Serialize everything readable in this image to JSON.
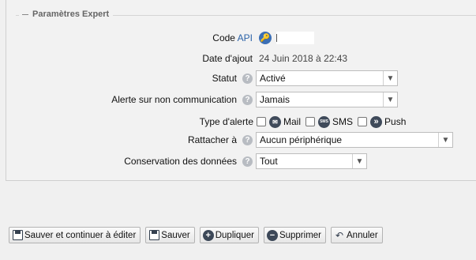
{
  "fieldset": {
    "legend": "Paramètres Expert"
  },
  "fields": {
    "code_api": {
      "label_prefix": "Code ",
      "label_link": "API"
    },
    "date_ajout": {
      "label": "Date d'ajout",
      "value": "24 Juin 2018 à 22:43"
    },
    "statut": {
      "label": "Statut",
      "value": "Activé"
    },
    "alerte": {
      "label": "Alerte sur non communication",
      "value": "Jamais"
    },
    "type_alerte": {
      "label": "Type d'alerte",
      "options": [
        {
          "label": "Mail",
          "icon": "mail-icon"
        },
        {
          "label": "SMS",
          "icon": "sms-icon"
        },
        {
          "label": "Push",
          "icon": "push-icon"
        }
      ]
    },
    "rattacher": {
      "label": "Rattacher à",
      "value": "Aucun périphérique"
    },
    "conservation": {
      "label": "Conservation des données",
      "value": "Tout"
    }
  },
  "icons": {
    "help": "?",
    "sms_glyph": "SMS",
    "push_glyph": "»"
  },
  "buttons": {
    "save_continue": "Sauver et continuer à éditer",
    "save": "Sauver",
    "duplicate": "Dupliquer",
    "delete": "Supprimer",
    "cancel": "Annuler"
  }
}
